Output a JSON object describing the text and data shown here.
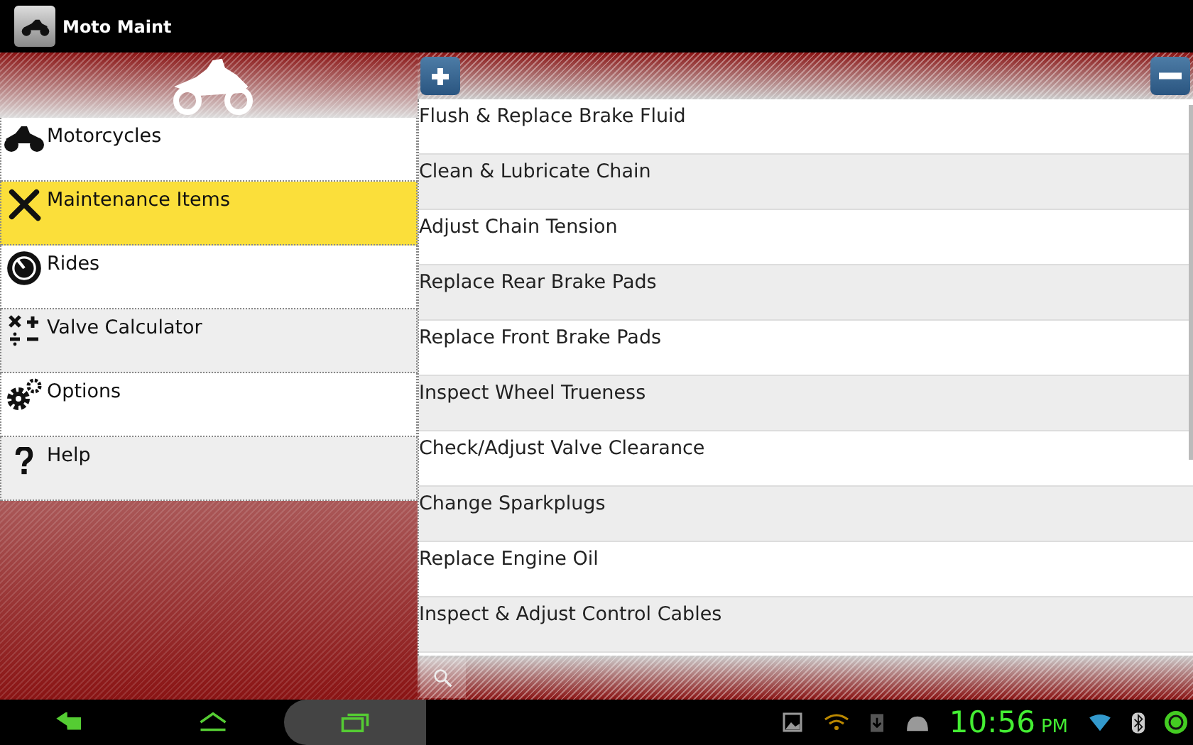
{
  "window": {
    "title": "Moto Maint"
  },
  "sidebar": {
    "items": [
      {
        "label": "Motorcycles",
        "selected": false
      },
      {
        "label": "Maintenance Items",
        "selected": true
      },
      {
        "label": "Rides",
        "selected": false
      },
      {
        "label": "Valve Calculator",
        "selected": false
      },
      {
        "label": "Options",
        "selected": false
      },
      {
        "label": "Help",
        "selected": false
      }
    ]
  },
  "list": {
    "items": [
      "Flush & Replace Brake Fluid",
      "Clean & Lubricate Chain",
      "Adjust Chain Tension",
      "Replace Rear Brake Pads",
      "Replace Front Brake Pads",
      "Inspect Wheel Trueness",
      "Check/Adjust Valve Clearance",
      "Change Sparkplugs",
      "Replace Engine Oil",
      "Inspect & Adjust Control Cables"
    ]
  },
  "status_bar": {
    "time": "10:56",
    "ampm": "PM"
  }
}
